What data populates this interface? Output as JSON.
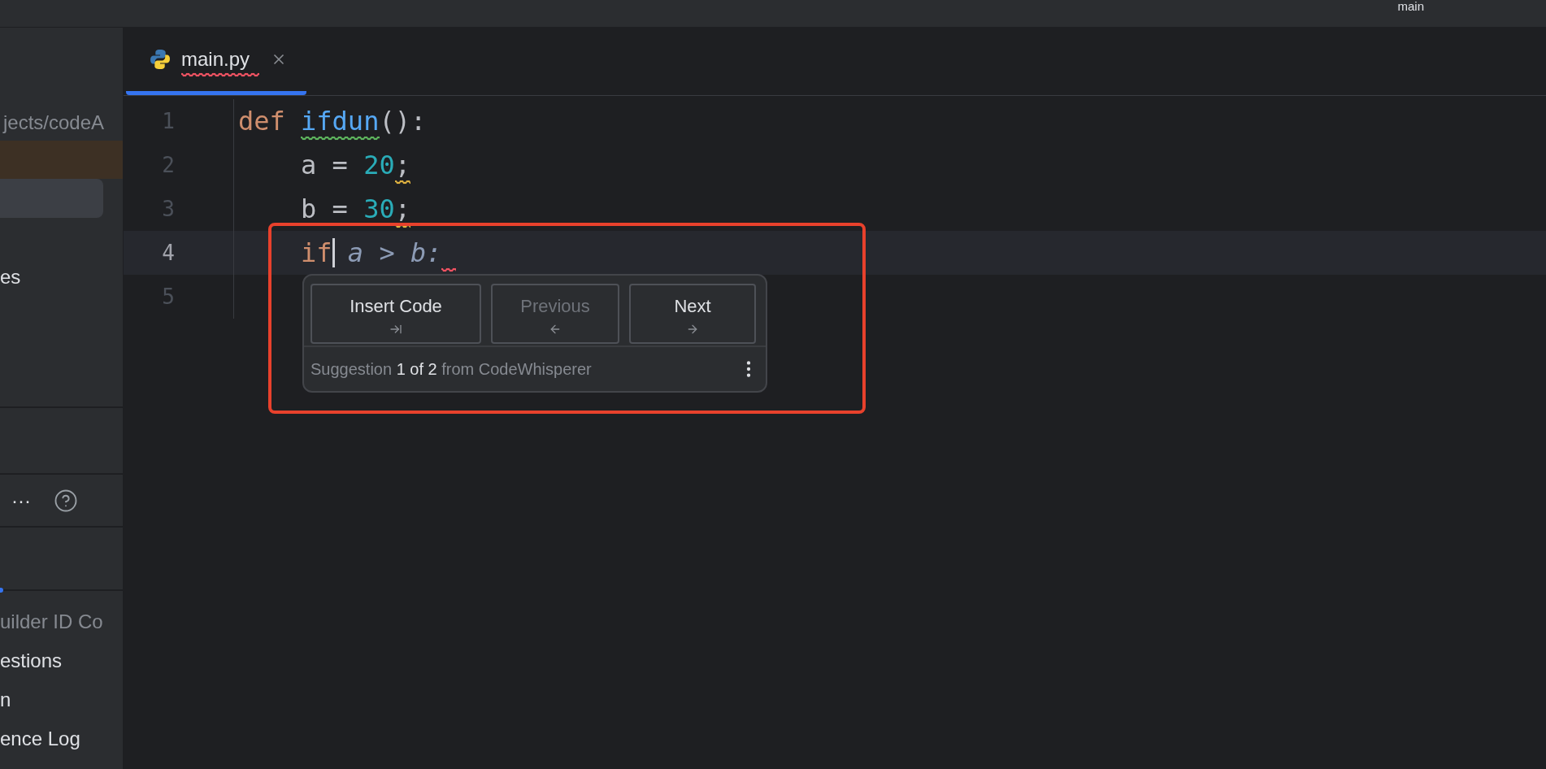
{
  "top_bar": {
    "branch": "main"
  },
  "sidebar": {
    "path": "jects/codeA",
    "item": "es",
    "more": "···",
    "items": [
      {
        "label": "uilder ID Co",
        "dimmed": true
      },
      {
        "label": "estions",
        "dimmed": false
      },
      {
        "label": "n",
        "dimmed": false
      },
      {
        "label": "ence Log",
        "dimmed": false
      }
    ]
  },
  "tabs": [
    {
      "label": "main.py",
      "selected": true,
      "error": true
    }
  ],
  "editor": {
    "lines": [
      {
        "number": "1",
        "current": false,
        "tokens": [
          {
            "text": "def ",
            "kind": "keyword"
          },
          {
            "text": "ifdun",
            "kind": "func",
            "typo": true
          },
          {
            "text": "():",
            "kind": "punct"
          }
        ]
      },
      {
        "number": "2",
        "current": false,
        "tokens": [
          {
            "text": "    a = ",
            "kind": "plain"
          },
          {
            "text": "20",
            "kind": "num"
          },
          {
            "text": ";",
            "kind": "punct",
            "warning": true
          }
        ]
      },
      {
        "number": "3",
        "current": false,
        "tokens": [
          {
            "text": "    b = ",
            "kind": "plain"
          },
          {
            "text": "30",
            "kind": "num"
          },
          {
            "text": ";",
            "kind": "punct",
            "warning": true
          }
        ]
      },
      {
        "number": "4",
        "current": true,
        "error_after": true,
        "tokens": [
          {
            "text": "    if",
            "kind": "keyword",
            "caret": true
          },
          {
            "text": " a > b:",
            "kind": "ghost"
          }
        ]
      },
      {
        "number": "5",
        "current": false
      }
    ]
  },
  "suggestion_popup": {
    "buttons": [
      {
        "label": "Insert Code",
        "kind": "insert",
        "disabled": false
      },
      {
        "label": "Previous",
        "kind": "previous",
        "disabled": true
      },
      {
        "label": "Next",
        "kind": "next",
        "disabled": false
      }
    ],
    "status": "Suggestion **1 of 2** from CodeWhisperer"
  }
}
